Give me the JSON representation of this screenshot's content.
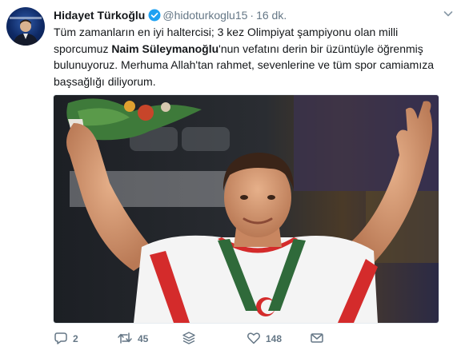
{
  "tweet": {
    "author_name": "Hidayet Türkoğlu",
    "handle": "@hidoturkoglu15",
    "separator": "·",
    "time": "16 dk.",
    "text_part1": "Tüm zamanların en iyi haltercisi; 3 kez Olimpiyat şampiyonu olan milli sporcumuz ",
    "text_bold": "Naim Süleymanoğlu",
    "text_part2": "'nun vefatını derin bir üzüntüyle öğrenmiş bulunuyoruz. Merhuma Allah'tan rahmet, sevenlerine ve tüm spor camiamıza başsağlığı diliyorum."
  },
  "actions": {
    "reply_count": "2",
    "retweet_count": "45",
    "like_count": "148"
  },
  "icons": {
    "verified": "verified-badge-icon",
    "caret": "chevron-down-icon",
    "reply": "reply-icon",
    "retweet": "retweet-icon",
    "stack": "stack-icon",
    "like": "heart-icon",
    "dm": "envelope-icon"
  },
  "colors": {
    "verified_blue": "#1da1f2",
    "secondary_text": "#657786",
    "primary_text": "#14171a"
  }
}
